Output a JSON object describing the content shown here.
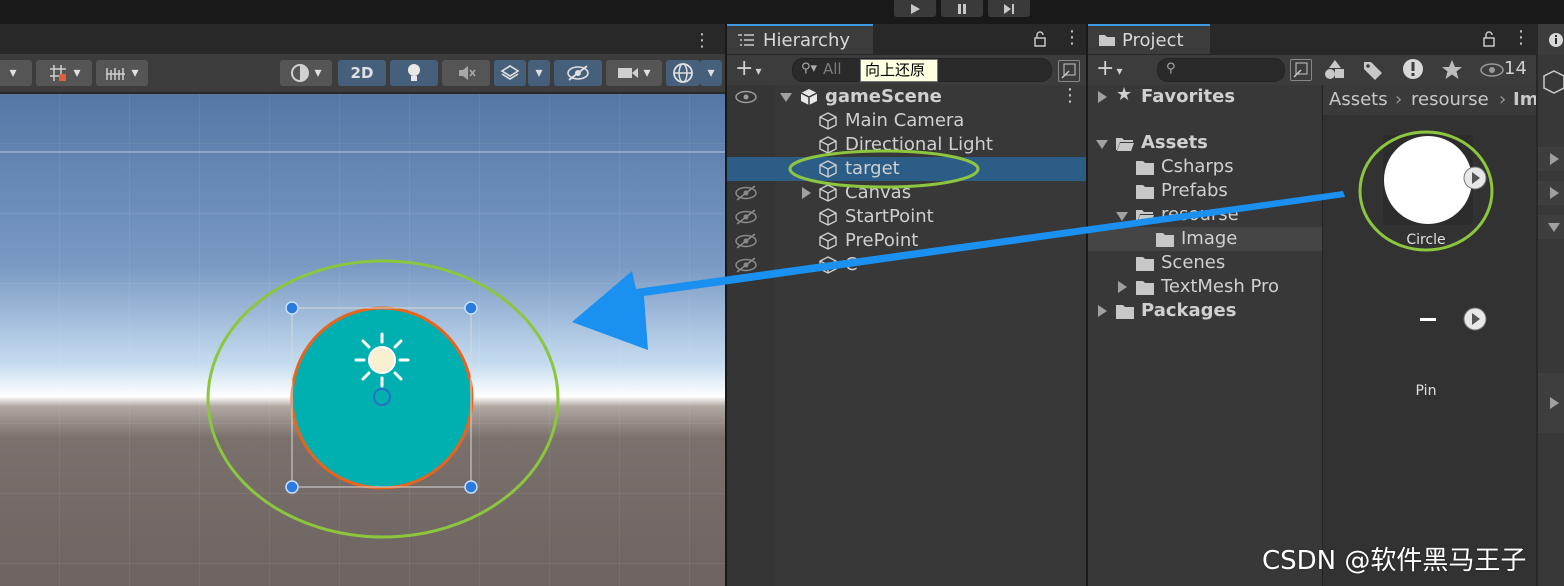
{
  "scene": {
    "tools": {
      "mode_2d": "2D"
    }
  },
  "hierarchy": {
    "tab_label": "Hierarchy",
    "search_placeholder": "All",
    "tooltip": "向上还原",
    "scene_name": "gameScene",
    "items": [
      {
        "label": "Main Camera"
      },
      {
        "label": "Directional Light"
      },
      {
        "label": "target",
        "selected": true
      },
      {
        "label": "Canvas"
      },
      {
        "label": "StartPoint"
      },
      {
        "label": "PrePoint"
      },
      {
        "label": "C"
      }
    ]
  },
  "project": {
    "tab_label": "Project",
    "search_placeholder": "",
    "eye_count": "14",
    "tree": {
      "favorites": "Favorites",
      "assets": "Assets",
      "children": [
        "Csharps",
        "Prefabs",
        "resourse",
        "Image",
        "Scenes",
        "TextMesh Pro"
      ],
      "packages": "Packages"
    },
    "breadcrumb": [
      "Assets",
      "resourse",
      "Im"
    ],
    "assets": [
      {
        "name": "Circle"
      },
      {
        "name": "Pin"
      }
    ]
  },
  "colors": {
    "selection": "#2c5d87",
    "annotation": "#8cc63f",
    "arrow": "#1a90f0",
    "sprite": "#00b0b0",
    "outline": "#e8641c"
  },
  "watermark": "CSDN @软件黑马王子"
}
